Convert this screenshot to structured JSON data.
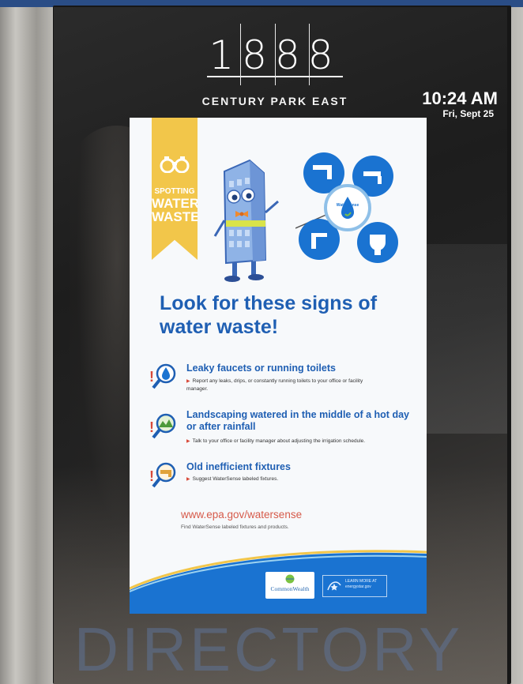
{
  "kiosk": {
    "building_number": "1888",
    "building_street": "CENTURY PARK EAST",
    "time": "10:24 AM",
    "date": "Fri, Sept 25",
    "footer_label": "DIRECTORY"
  },
  "poster": {
    "ribbon": {
      "line1": "SPOTTING",
      "line2": "WATER",
      "line3": "WASTE"
    },
    "badge_text": "WaterSense",
    "headline_line1": "Look for these signs of",
    "headline_line2": "water waste!",
    "signs": [
      {
        "title": "Leaky faucets or running toilets",
        "body": "Report any leaks, drips, or constantly running toilets to your office or facility manager."
      },
      {
        "title_line1": "Landscaping watered in the middle of a hot day",
        "title_line2": "or after rainfall",
        "body": "Talk to your office or facility manager about adjusting the irrigation schedule."
      },
      {
        "title": "Old inefficient fixtures",
        "body": "Suggest WaterSense labeled fixtures."
      }
    ],
    "url": "www.epa.gov/watersense",
    "url_caption": "Find WaterSense labeled fixtures and products.",
    "partner_logo": "CommonWealth",
    "energy_logo": "LEARN MORE AT energystar.gov"
  },
  "colors": {
    "headline_blue": "#1f5fb3",
    "ribbon_yellow": "#f2c64a",
    "url_red": "#d65a4a",
    "footer_blue": "#1a73d1"
  }
}
